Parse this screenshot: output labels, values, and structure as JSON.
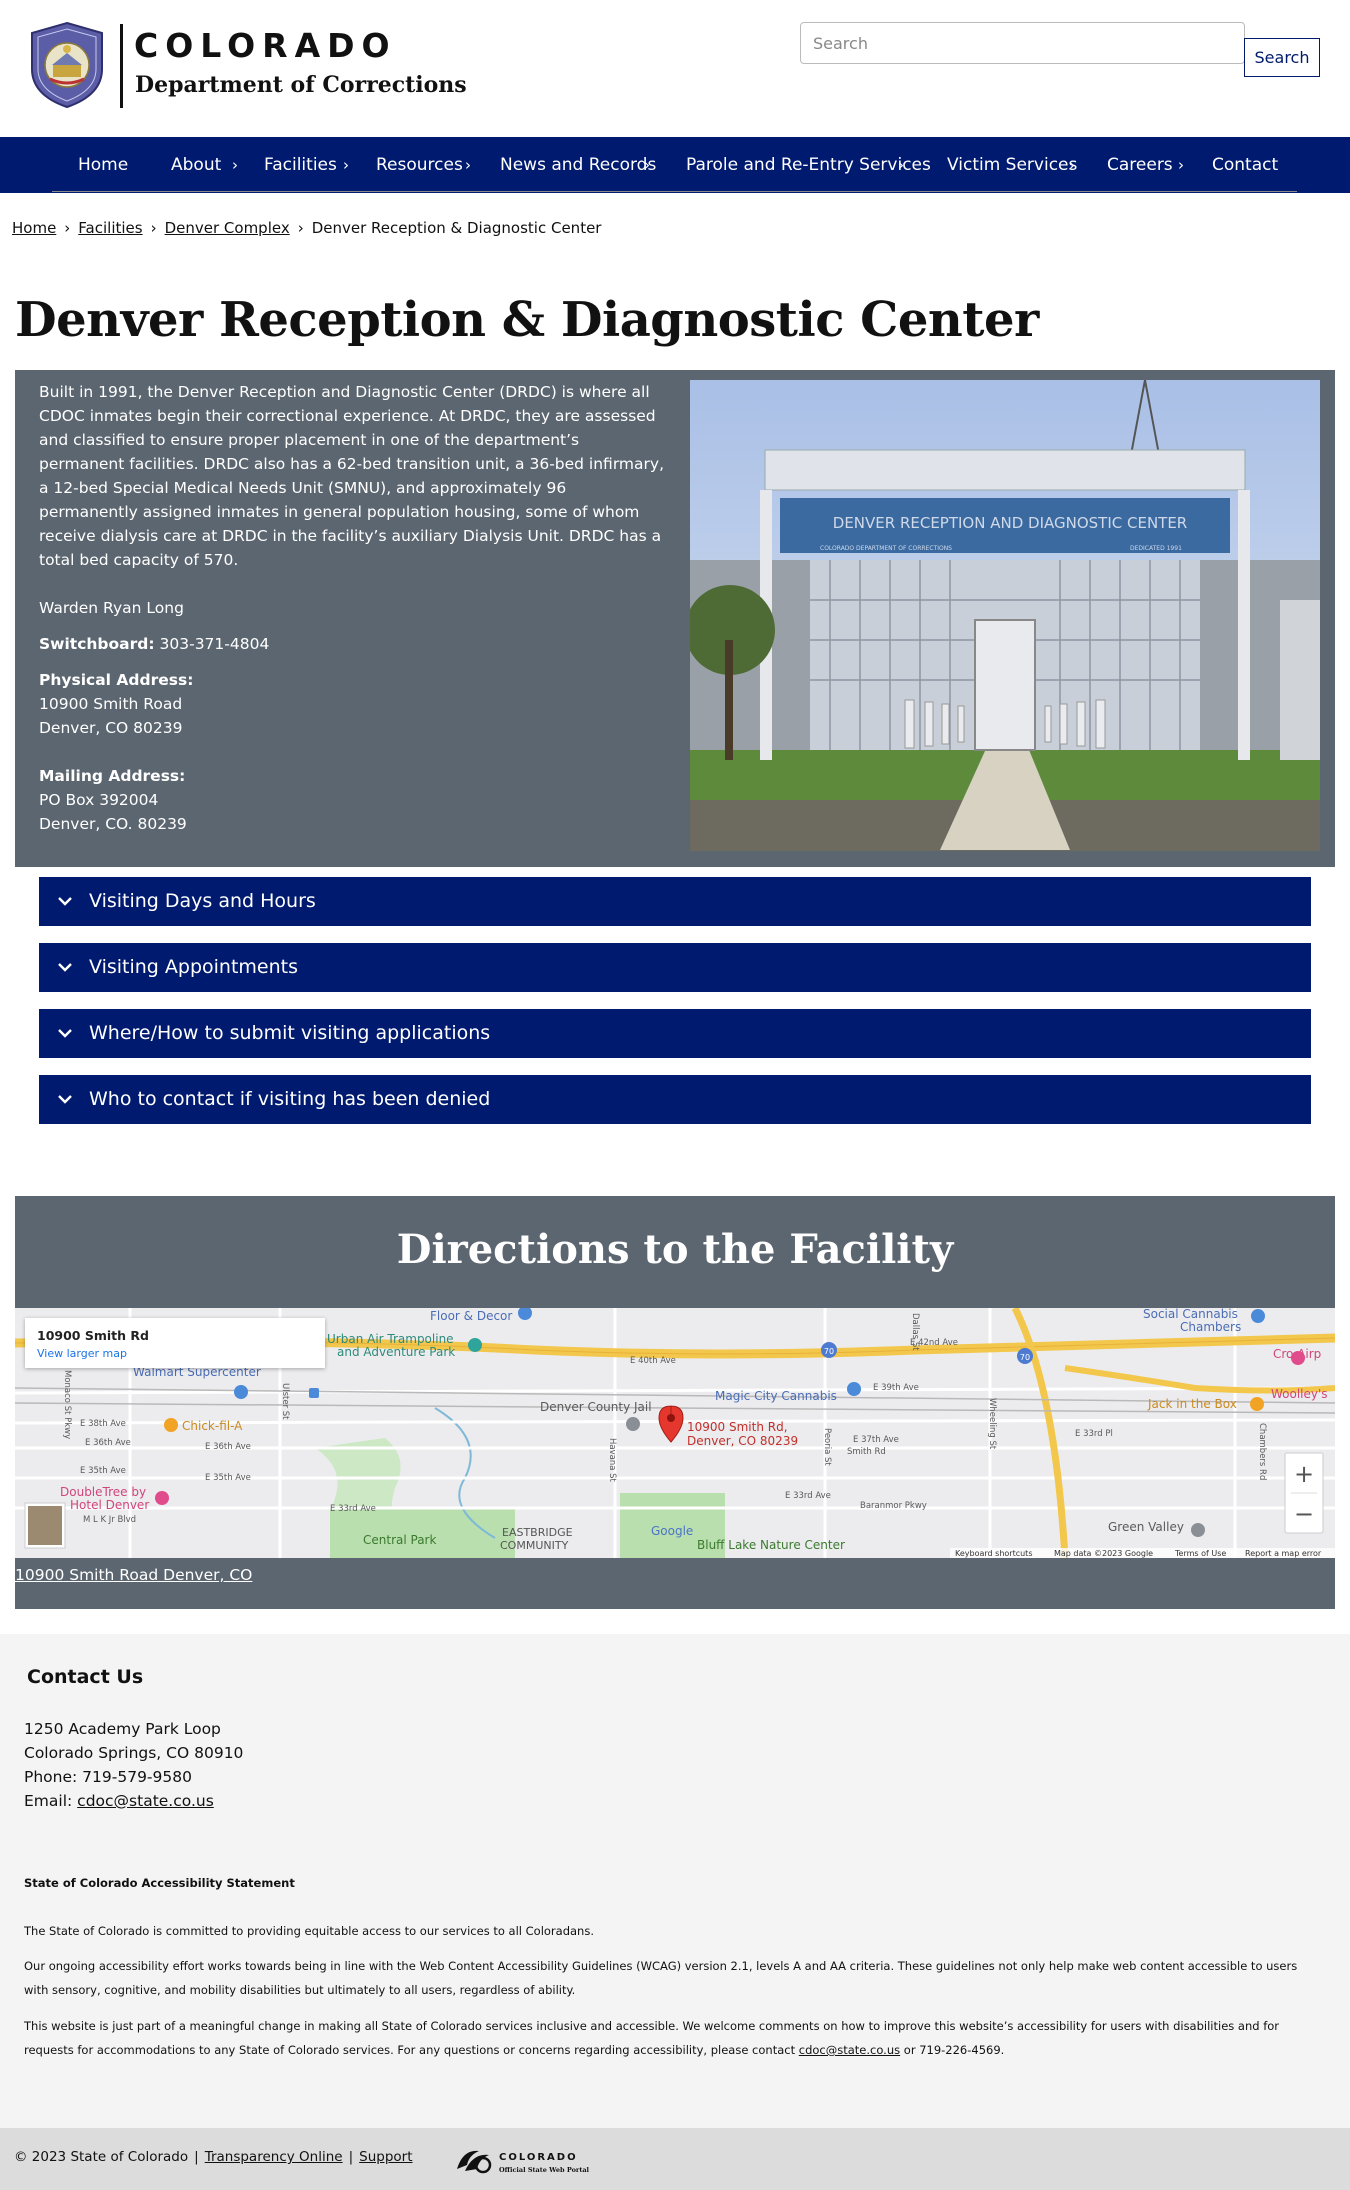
{
  "header": {
    "brand_name": "COLORADO",
    "department": "Department of Corrections",
    "search_placeholder": "Search",
    "search_button": "Search"
  },
  "nav": {
    "items": [
      {
        "label": "Home"
      },
      {
        "label": "About"
      },
      {
        "label": "Facilities"
      },
      {
        "label": "Resources"
      },
      {
        "label": "News and Records"
      },
      {
        "label": "Parole and Re-Entry Services"
      },
      {
        "label": "Victim Services"
      },
      {
        "label": "Careers"
      },
      {
        "label": "Contact"
      }
    ],
    "chevron": "›"
  },
  "breadcrumb": {
    "items": [
      "Home",
      "Facilities",
      "Denver Complex",
      "Denver Reception & Diagnostic Center"
    ],
    "separator": "›"
  },
  "page": {
    "title": "Denver Reception & Diagnostic Center",
    "description": "Built in 1991, the Denver Reception and Diagnostic Center (DRDC) is where all CDOC inmates begin their correctional experience.  At DRDC, they are assessed and classified to ensure proper placement in one of the department’s permanent facilities.  DRDC also has a 62-bed transition unit, a 36-bed infirmary, a 12-bed Special Medical Needs Unit (SMNU), and approximately 96 permanently assigned inmates in general population housing, some of whom receive dialysis care at DRDC in the facility’s auxiliary Dialysis Unit.  DRDC has a total bed capacity of 570.",
    "warden": "Warden Ryan Long",
    "switchboard_label": "Switchboard:",
    "switchboard_value": "303-371-4804",
    "physical_label": "Physical Address:",
    "physical_line1": "10900 Smith Road",
    "physical_line2": "Denver, CO 80239",
    "mailing_label": "Mailing Address:",
    "mailing_line1": "PO Box 392004",
    "mailing_line2": "Denver, CO. 80239",
    "photo_sign_text": "DENVER RECEPTION AND DIAGNOSTIC CENTER",
    "photo_sign_small_left": "COLORADO DEPARTMENT OF CORRECTIONS",
    "photo_sign_small_right": "DEDICATED 1991"
  },
  "accordions": [
    {
      "label": "Visiting Days and Hours"
    },
    {
      "label": "Visiting Appointments"
    },
    {
      "label": "Where/How to submit visiting applications"
    },
    {
      "label": "Who to contact if visiting has been denied"
    }
  ],
  "directions": {
    "title": "Directions to the Facility",
    "map_card_title": "10900 Smith Rd",
    "map_card_link": "View larger map",
    "pin_label_line1": "10900 Smith Rd,",
    "pin_label_line2": "Denver, CO 80239",
    "map_places": {
      "floor_decor": "Floor & Decor",
      "urban_air_1": "Urban Air Trampoline",
      "urban_air_2": "and Adventure Park",
      "walmart": "Walmart Supercenter",
      "social_cannabis_1": "Social Cannabis",
      "social_cannabis_2": "Chambers",
      "chick_fil_a": "Chick-fil-A",
      "denver_county_jail": "Denver County Jail",
      "magic_city": "Magic City Cannabis",
      "jack_in_the_box": "Jack in the Box",
      "woolleys": "Woolley's",
      "doubletree_1": "DoubleTree by",
      "doubletree_2": "Hotel Denver",
      "central_park": "Central Park",
      "eastbridge_1": "EASTBRIDGE",
      "eastbridge_2": "COMMUNITY",
      "bluff_lake": "Bluff Lake Nature Center",
      "green_valley": "Green Valley",
      "cro_air": "Cro Airp"
    },
    "map_streets": {
      "e40th": "E 40th Ave",
      "e42nd": "E 42nd Ave",
      "e39th": "E 39th Ave",
      "e38th": "E 38th Ave",
      "e37th": "E 37th Ave",
      "e36th": "E 36th Ave",
      "e36th_b": "E 36th Ave",
      "e35th": "E 35th Ave",
      "e33rd": "E 33rd Ave",
      "e33rd_b": "E 33rd Ave",
      "e33rd_pl": "E 33rd Pl",
      "smith_rd": "Smith Rd",
      "mlk": "M L K Jr Blvd",
      "havana": "Havana St",
      "peoria": "Peoria St",
      "wheeling": "Wheeling St",
      "chambers": "Chambers Rd",
      "monaco": "Monaco St Pkwy",
      "ulster": "Ulster St",
      "dallas": "Dallas St",
      "i70": "70",
      "baranmor": "Baranmor Pkwy"
    },
    "map_zoom_in": "+",
    "map_zoom_out": "−",
    "map_google": "Google",
    "map_attribution_1": "Keyboard shortcuts",
    "map_attribution_2": "Map data ©2023 Google",
    "map_attribution_3": "Terms of Use",
    "map_attribution_4": "Report a map error",
    "address_link": "10900 Smith Road Denver, CO"
  },
  "footer": {
    "contact_title": "Contact Us",
    "address_line1": "1250 Academy Park Loop",
    "address_line2": "Colorado Springs, CO 80910",
    "phone": "Phone: 719-579-9580",
    "email_label": "Email:",
    "email": "cdoc@state.co.us",
    "accessibility_title": "State of Colorado Accessibility Statement",
    "accessibility_p1": "The State of Colorado is committed to providing equitable access to our services to all Coloradans.",
    "accessibility_p2": "Our ongoing accessibility effort works towards being in line with the Web Content Accessibility Guidelines (WCAG) version 2.1, levels A and AA criteria. These guidelines not only help make web content accessible to users with sensory, cognitive, and mobility disabilities but ultimately to all users, regardless of ability.",
    "accessibility_p3": "This website is just part of a meaningful change in making all State of Colorado services inclusive and accessible. We welcome comments on how to improve this website’s accessibility for users with disabilities and for requests for accommodations to any State of Colorado services. For any questions or concerns regarding accessibility, please contact",
    "accessibility_email": "cdoc@state.co.us",
    "accessibility_phone": "or 719-226-4569.",
    "copyright": "© 2023 State of Colorado",
    "transparency": "Transparency Online",
    "support": "Support",
    "portal_name": "COLORADO",
    "portal_sub": "Official State Web Portal",
    "pipe": "|"
  },
  "colors": {
    "nav_blue": "#001a70",
    "panel_gray": "#5c6670",
    "footer_bg": "#f4f4f4"
  }
}
